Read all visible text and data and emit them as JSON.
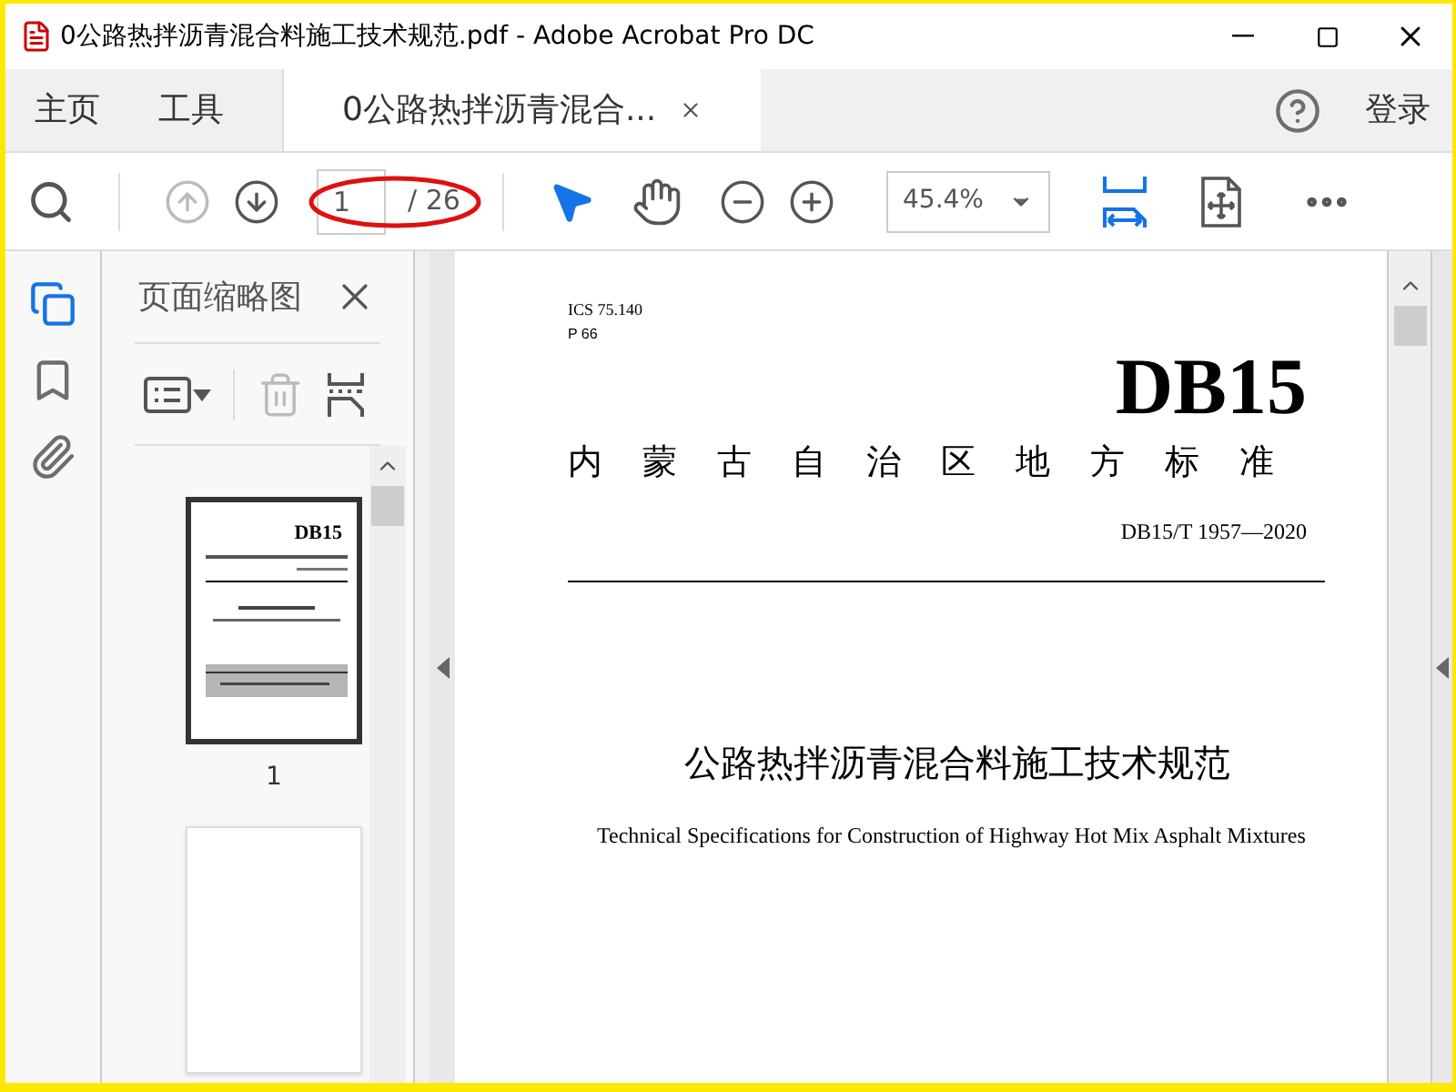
{
  "window": {
    "title": "0公路热拌沥青混合料施工技术规范.pdf - Adobe Acrobat Pro DC"
  },
  "tabs": [
    {
      "label": "主页",
      "selected": false
    },
    {
      "label": "工具",
      "selected": false
    },
    {
      "label": "0公路热拌沥青混合...",
      "selected": true
    }
  ],
  "account": {
    "login": "登录"
  },
  "toolbar": {
    "page_number": "1",
    "page_total": "/ 26",
    "zoom": "45.4%"
  },
  "rail": [
    {
      "kind": "pages",
      "selected": true
    },
    {
      "kind": "bookmarks",
      "selected": false
    },
    {
      "kind": "attachments",
      "selected": false
    }
  ],
  "panel": {
    "title": "页面缩略图",
    "thumbnails": [
      {
        "label": "1",
        "heading": "DB15",
        "selected": true
      },
      {
        "selected": false
      }
    ]
  },
  "document": {
    "ics": "ICS 75.140",
    "ccs": "P 66",
    "code": "DB15",
    "authority": "内蒙古自治区地方标准",
    "number": "DB15/T 1957—2020",
    "title": "公路热拌沥青混合料施工技术规范",
    "subtitle": "Technical Specifications for Construction of Highway Hot Mix Asphalt Mixtures"
  }
}
